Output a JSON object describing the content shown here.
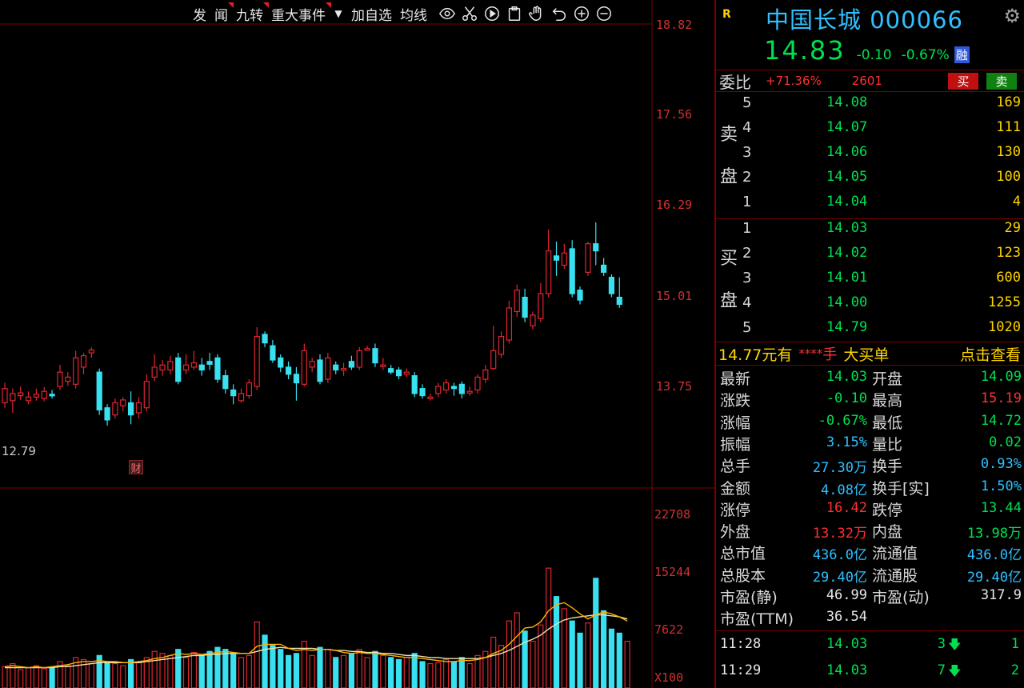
{
  "toolbar": {
    "items": [
      "发",
      "闻",
      "九转",
      "重大事件",
      "加自选",
      "均线"
    ],
    "dropdown_glyph": "▼"
  },
  "chart_data": [
    {
      "type": "candlestick",
      "title": "",
      "y_ticks": [
        "18.82",
        "17.56",
        "16.29",
        "15.01",
        "13.75"
      ],
      "low_marker": "12.79",
      "event_badge": "财",
      "candles": [
        {
          "o": 13.52,
          "c": 13.72,
          "h": 13.8,
          "l": 13.45
        },
        {
          "o": 13.55,
          "c": 13.65,
          "h": 13.72,
          "l": 13.38
        },
        {
          "o": 13.62,
          "c": 13.66,
          "h": 13.75,
          "l": 13.56
        },
        {
          "o": 13.55,
          "c": 13.6,
          "h": 13.68,
          "l": 13.5
        },
        {
          "o": 13.6,
          "c": 13.64,
          "h": 13.72,
          "l": 13.55
        },
        {
          "o": 13.58,
          "c": 13.68,
          "h": 13.74,
          "l": 13.54
        },
        {
          "o": 13.64,
          "c": 13.62,
          "h": 13.7,
          "l": 13.58
        },
        {
          "o": 13.75,
          "c": 13.95,
          "h": 14.05,
          "l": 13.7
        },
        {
          "o": 13.82,
          "c": 13.88,
          "h": 13.95,
          "l": 13.76
        },
        {
          "o": 13.78,
          "c": 14.15,
          "h": 14.25,
          "l": 13.72
        },
        {
          "o": 14.02,
          "c": 14.18,
          "h": 14.22,
          "l": 13.92
        },
        {
          "o": 14.22,
          "c": 14.26,
          "h": 14.3,
          "l": 14.15
        },
        {
          "o": 13.95,
          "c": 13.42,
          "h": 14.0,
          "l": 13.35
        },
        {
          "o": 13.45,
          "c": 13.28,
          "h": 13.5,
          "l": 13.2
        },
        {
          "o": 13.35,
          "c": 13.52,
          "h": 13.58,
          "l": 13.3
        },
        {
          "o": 13.48,
          "c": 13.56,
          "h": 13.6,
          "l": 13.4
        },
        {
          "o": 13.52,
          "c": 13.35,
          "h": 13.68,
          "l": 13.22
        },
        {
          "o": 13.38,
          "c": 13.52,
          "h": 13.6,
          "l": 13.3
        },
        {
          "o": 13.45,
          "c": 13.82,
          "h": 13.92,
          "l": 13.4
        },
        {
          "o": 13.88,
          "c": 14.02,
          "h": 14.2,
          "l": 13.82
        },
        {
          "o": 13.98,
          "c": 14.05,
          "h": 14.12,
          "l": 13.9
        },
        {
          "o": 13.98,
          "c": 14.1,
          "h": 14.18,
          "l": 13.92
        },
        {
          "o": 14.15,
          "c": 13.82,
          "h": 14.22,
          "l": 13.78
        },
        {
          "o": 13.98,
          "c": 14.05,
          "h": 14.2,
          "l": 13.92
        },
        {
          "o": 14.02,
          "c": 14.08,
          "h": 14.25,
          "l": 13.98
        },
        {
          "o": 14.05,
          "c": 13.98,
          "h": 14.15,
          "l": 13.9
        },
        {
          "o": 14.1,
          "c": 14.06,
          "h": 14.22,
          "l": 13.98
        },
        {
          "o": 14.15,
          "c": 13.85,
          "h": 14.2,
          "l": 13.8
        },
        {
          "o": 13.9,
          "c": 13.72,
          "h": 13.98,
          "l": 13.65
        },
        {
          "o": 13.7,
          "c": 13.62,
          "h": 13.78,
          "l": 13.5
        },
        {
          "o": 13.55,
          "c": 13.65,
          "h": 13.72,
          "l": 13.52
        },
        {
          "o": 13.62,
          "c": 13.8,
          "h": 13.85,
          "l": 13.58
        },
        {
          "o": 13.75,
          "c": 14.45,
          "h": 14.58,
          "l": 13.7
        },
        {
          "o": 14.48,
          "c": 14.36,
          "h": 14.52,
          "l": 14.3
        },
        {
          "o": 14.32,
          "c": 14.12,
          "h": 14.4,
          "l": 14.08
        },
        {
          "o": 14.15,
          "c": 14.02,
          "h": 14.2,
          "l": 13.95
        },
        {
          "o": 14.02,
          "c": 13.92,
          "h": 14.1,
          "l": 13.85
        },
        {
          "o": 13.92,
          "c": 13.8,
          "h": 14.02,
          "l": 13.55
        },
        {
          "o": 13.78,
          "c": 14.25,
          "h": 14.35,
          "l": 13.75
        },
        {
          "o": 14.02,
          "c": 14.1,
          "h": 14.15,
          "l": 13.95
        },
        {
          "o": 14.12,
          "c": 13.82,
          "h": 14.2,
          "l": 13.78
        },
        {
          "o": 13.85,
          "c": 14.15,
          "h": 14.22,
          "l": 13.8
        },
        {
          "o": 14.05,
          "c": 13.98,
          "h": 14.1,
          "l": 13.92
        },
        {
          "o": 13.98,
          "c": 14.0,
          "h": 14.08,
          "l": 13.9
        },
        {
          "o": 14.1,
          "c": 14.02,
          "h": 14.18,
          "l": 13.98
        },
        {
          "o": 14.02,
          "c": 14.25,
          "h": 14.3,
          "l": 13.98
        },
        {
          "o": 14.28,
          "c": 14.28,
          "h": 14.32,
          "l": 14.25
        },
        {
          "o": 14.28,
          "c": 14.08,
          "h": 14.35,
          "l": 14.02
        },
        {
          "o": 14.05,
          "c": 14.05,
          "h": 14.15,
          "l": 13.98
        },
        {
          "o": 14.0,
          "c": 13.95,
          "h": 14.05,
          "l": 13.92
        },
        {
          "o": 13.98,
          "c": 13.9,
          "h": 14.02,
          "l": 13.85
        },
        {
          "o": 13.92,
          "c": 13.95,
          "h": 14.0,
          "l": 13.88
        },
        {
          "o": 13.9,
          "c": 13.65,
          "h": 13.95,
          "l": 13.6
        },
        {
          "o": 13.72,
          "c": 13.62,
          "h": 13.78,
          "l": 13.58
        },
        {
          "o": 13.6,
          "c": 13.6,
          "h": 13.65,
          "l": 13.55
        },
        {
          "o": 13.65,
          "c": 13.75,
          "h": 13.8,
          "l": 13.6
        },
        {
          "o": 13.7,
          "c": 13.8,
          "h": 13.85,
          "l": 13.65
        },
        {
          "o": 13.75,
          "c": 13.72,
          "h": 13.8,
          "l": 13.62
        },
        {
          "o": 13.78,
          "c": 13.65,
          "h": 13.82,
          "l": 13.58
        },
        {
          "o": 13.68,
          "c": 13.68,
          "h": 13.75,
          "l": 13.62
        },
        {
          "o": 13.7,
          "c": 13.88,
          "h": 13.92,
          "l": 13.65
        },
        {
          "o": 13.85,
          "c": 13.98,
          "h": 14.05,
          "l": 13.8
        },
        {
          "o": 14.0,
          "c": 14.25,
          "h": 14.6,
          "l": 13.98
        },
        {
          "o": 14.2,
          "c": 14.45,
          "h": 14.52,
          "l": 14.15
        },
        {
          "o": 14.4,
          "c": 14.85,
          "h": 14.95,
          "l": 14.35
        },
        {
          "o": 14.8,
          "c": 15.1,
          "h": 15.18,
          "l": 14.72
        },
        {
          "o": 15.0,
          "c": 14.72,
          "h": 15.12,
          "l": 14.65
        },
        {
          "o": 14.6,
          "c": 14.75,
          "h": 14.8,
          "l": 14.55
        },
        {
          "o": 14.7,
          "c": 15.05,
          "h": 15.2,
          "l": 14.65
        },
        {
          "o": 15.05,
          "c": 15.65,
          "h": 15.95,
          "l": 15.0
        },
        {
          "o": 15.58,
          "c": 15.52,
          "h": 15.78,
          "l": 15.3
        },
        {
          "o": 15.45,
          "c": 15.62,
          "h": 15.75,
          "l": 15.4
        },
        {
          "o": 15.68,
          "c": 15.05,
          "h": 15.8,
          "l": 15.0
        },
        {
          "o": 15.1,
          "c": 14.96,
          "h": 15.15,
          "l": 14.9
        },
        {
          "o": 15.35,
          "c": 15.75,
          "h": 15.78,
          "l": 15.3
        },
        {
          "o": 15.75,
          "c": 15.65,
          "h": 16.05,
          "l": 15.45
        },
        {
          "o": 15.45,
          "c": 15.35,
          "h": 15.55,
          "l": 15.3
        },
        {
          "o": 15.28,
          "c": 15.05,
          "h": 15.32,
          "l": 15.0
        },
        {
          "o": 15.0,
          "c": 14.9,
          "h": 15.28,
          "l": 14.85
        }
      ]
    },
    {
      "type": "bar",
      "title": "",
      "y_ticks": [
        "22708",
        "15244",
        "7622"
      ],
      "unit_label": "X100",
      "volumes": [
        2.1,
        2.4,
        1.8,
        2.0,
        2.2,
        1.9,
        2.0,
        2.6,
        2.2,
        3.0,
        2.8,
        2.4,
        3.2,
        2.6,
        2.4,
        2.2,
        2.8,
        2.5,
        3.0,
        3.6,
        3.4,
        3.2,
        3.8,
        3.0,
        3.5,
        3.2,
        3.6,
        4.0,
        3.8,
        3.4,
        3.0,
        3.2,
        6.5,
        5.2,
        4.2,
        3.8,
        3.2,
        3.4,
        4.6,
        3.2,
        4.0,
        3.8,
        3.0,
        3.2,
        3.4,
        3.8,
        3.0,
        3.6,
        3.2,
        3.0,
        2.8,
        3.0,
        3.4,
        2.6,
        2.4,
        2.5,
        2.8,
        2.6,
        3.0,
        2.4,
        3.2,
        3.6,
        5.0,
        4.2,
        6.6,
        7.4,
        5.6,
        4.6,
        6.2,
        11.8,
        9.0,
        7.8,
        6.6,
        5.4,
        6.4,
        10.8,
        7.6,
        5.8,
        5.4,
        4.6
      ],
      "ma_fast": [
        2.1,
        2.2,
        2.1,
        2.0,
        2.1,
        2.0,
        2.1,
        2.2,
        2.3,
        2.5,
        2.6,
        2.6,
        2.7,
        2.6,
        2.6,
        2.5,
        2.5,
        2.6,
        2.7,
        2.9,
        3.0,
        3.2,
        3.4,
        3.3,
        3.4,
        3.3,
        3.4,
        3.5,
        3.6,
        3.5,
        3.4,
        3.4,
        4.1,
        4.3,
        4.3,
        4.3,
        3.9,
        3.7,
        3.8,
        3.7,
        3.8,
        3.8,
        3.7,
        3.5,
        3.4,
        3.5,
        3.4,
        3.4,
        3.3,
        3.2,
        3.1,
        3.0,
        3.0,
        2.9,
        2.8,
        2.7,
        2.6,
        2.6,
        2.7,
        2.7,
        2.8,
        3.0,
        3.4,
        3.7,
        4.3,
        5.1,
        5.9,
        6.0,
        6.5,
        7.6,
        8.2,
        8.4,
        7.9,
        7.3,
        6.8,
        7.2,
        7.5,
        7.3,
        7.0,
        6.6
      ],
      "ma_slow": [
        2.0,
        2.0,
        2.0,
        2.0,
        2.0,
        2.0,
        2.0,
        2.1,
        2.1,
        2.2,
        2.3,
        2.4,
        2.5,
        2.5,
        2.5,
        2.5,
        2.5,
        2.5,
        2.6,
        2.7,
        2.8,
        2.9,
        3.0,
        3.1,
        3.2,
        3.2,
        3.3,
        3.3,
        3.4,
        3.4,
        3.4,
        3.4,
        3.6,
        3.8,
        3.9,
        4.0,
        3.9,
        3.9,
        3.9,
        3.9,
        3.8,
        3.8,
        3.7,
        3.7,
        3.6,
        3.6,
        3.5,
        3.5,
        3.4,
        3.4,
        3.3,
        3.2,
        3.2,
        3.1,
        3.0,
        3.0,
        2.9,
        2.9,
        2.9,
        2.9,
        2.9,
        3.0,
        3.2,
        3.4,
        3.7,
        4.1,
        4.5,
        4.8,
        5.2,
        5.8,
        6.3,
        6.7,
        6.9,
        7.0,
        7.1,
        7.2,
        7.2,
        7.1,
        7.0,
        6.8
      ]
    }
  ],
  "stock": {
    "badge": "R",
    "title": "中国长城 000066",
    "price": "14.83",
    "change": "-0.10",
    "change_pct": "-0.67%",
    "market_tag": "融"
  },
  "weibi": {
    "label": "委比",
    "ratio": "+71.36%",
    "diff": "2601",
    "buy_btn": "买",
    "sell_btn": "卖"
  },
  "orderbook": {
    "sell_side_label": [
      "卖",
      "盘"
    ],
    "buy_side_label": [
      "买",
      "盘"
    ],
    "asks": [
      {
        "lvl": "5",
        "price": "14.08",
        "vol": "169"
      },
      {
        "lvl": "4",
        "price": "14.07",
        "vol": "111"
      },
      {
        "lvl": "3",
        "price": "14.06",
        "vol": "130"
      },
      {
        "lvl": "2",
        "price": "14.05",
        "vol": "100"
      },
      {
        "lvl": "1",
        "price": "14.04",
        "vol": "4"
      }
    ],
    "bids": [
      {
        "lvl": "1",
        "price": "14.03",
        "vol": "29"
      },
      {
        "lvl": "2",
        "price": "14.02",
        "vol": "123"
      },
      {
        "lvl": "3",
        "price": "14.01",
        "vol": "600"
      },
      {
        "lvl": "4",
        "price": "14.00",
        "vol": "1255"
      },
      {
        "lvl": "5",
        "price": "14.79",
        "vol": "1020"
      }
    ]
  },
  "big_order": {
    "amount": "14.77元有",
    "mask": "****",
    "unit": "手",
    "label": "大买单",
    "action": "点击查看"
  },
  "stats": [
    {
      "l": "最新",
      "lv": "14.03",
      "lc": "c-green",
      "r": "开盘",
      "rv": "14.09",
      "rc": "c-green"
    },
    {
      "l": "涨跌",
      "lv": "-0.10",
      "lc": "c-green",
      "r": "最高",
      "rv": "15.19",
      "rc": "c-red"
    },
    {
      "l": "涨幅",
      "lv": "-0.67%",
      "lc": "c-green",
      "r": "最低",
      "rv": "14.72",
      "rc": "c-green"
    },
    {
      "l": "振幅",
      "lv": "3.15%",
      "lc": "c-cyan",
      "r": "量比",
      "rv": "0.02",
      "rc": "c-green"
    },
    {
      "l": "总手",
      "lv": "27.30万",
      "lc": "c-cyan",
      "r": "换手",
      "rv": "0.93%",
      "rc": "c-cyan"
    },
    {
      "l": "金额",
      "lv": "4.08亿",
      "lc": "c-cyan",
      "r": "换手[实]",
      "rv": "1.50%",
      "rc": "c-cyan"
    },
    {
      "l": "涨停",
      "lv": "16.42",
      "lc": "c-red",
      "r": "跌停",
      "rv": "13.44",
      "rc": "c-green"
    },
    {
      "l": "外盘",
      "lv": "13.32万",
      "lc": "c-red",
      "r": "内盘",
      "rv": "13.98万",
      "rc": "c-green"
    },
    {
      "l": "总市值",
      "lv": "436.0亿",
      "lc": "c-cyan",
      "r": "流通值",
      "rv": "436.0亿",
      "rc": "c-cyan"
    },
    {
      "l": "总股本",
      "lv": "29.40亿",
      "lc": "c-cyan",
      "r": "流通股",
      "rv": "29.40亿",
      "rc": "c-cyan"
    },
    {
      "l": "市盈(静)",
      "lv": "46.99",
      "lc": "c-white",
      "r": "市盈(动)",
      "rv": "317.9",
      "rc": "c-white"
    },
    {
      "l": "市盈(TTM)",
      "lv": "36.54",
      "lc": "c-white",
      "r": "",
      "rv": "",
      "rc": "c-white"
    }
  ],
  "ticks": [
    {
      "time": "11:28",
      "price": "14.03",
      "vol": "3",
      "arrow": "🡇",
      "cnt": "1"
    },
    {
      "time": "11:29",
      "price": "14.03",
      "vol": "7",
      "arrow": "🡇",
      "cnt": "2"
    }
  ],
  "colors": {
    "up": "#e0252e",
    "down": "#38e0f0",
    "grid": "#7a0000",
    "ma_fast": "#ffb000",
    "ma_slow": "#f0e0b0"
  },
  "icons": [
    "eye-icon",
    "scissors-icon",
    "play-icon",
    "clipboard-icon",
    "hand-icon",
    "undo-icon",
    "zoom-in-icon",
    "zoom-out-icon",
    "gear-icon"
  ]
}
